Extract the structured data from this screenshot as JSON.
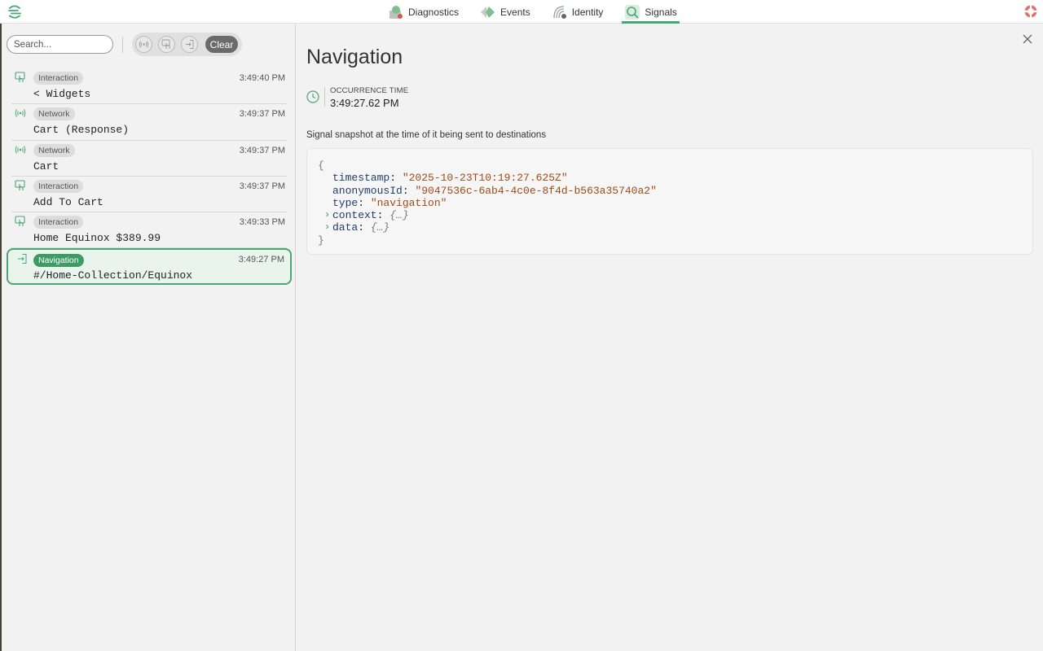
{
  "nav": {
    "tabs": [
      {
        "label": "Diagnostics",
        "icon": "diagnostics-icon"
      },
      {
        "label": "Events",
        "icon": "events-icon"
      },
      {
        "label": "Identity",
        "icon": "identity-icon"
      },
      {
        "label": "Signals",
        "icon": "signals-icon",
        "active": true
      }
    ]
  },
  "sidebar": {
    "search_placeholder": "Search...",
    "clear_label": "Clear",
    "signals": [
      {
        "type": "Interaction",
        "time": "3:49:40 PM",
        "title": "< Widgets",
        "icon": "interaction-icon"
      },
      {
        "type": "Network",
        "time": "3:49:37 PM",
        "title": "Cart (Response)",
        "icon": "network-icon"
      },
      {
        "type": "Network",
        "time": "3:49:37 PM",
        "title": "Cart",
        "icon": "network-icon"
      },
      {
        "type": "Interaction",
        "time": "3:49:37 PM",
        "title": "Add To Cart",
        "icon": "interaction-icon"
      },
      {
        "type": "Interaction",
        "time": "3:49:33 PM",
        "title": "Home Equinox $389.99",
        "icon": "interaction-icon"
      },
      {
        "type": "Navigation",
        "time": "3:49:27 PM",
        "title": "#/Home-Collection/Equinox",
        "icon": "navigation-icon",
        "selected": true
      }
    ]
  },
  "detail": {
    "title": "Navigation",
    "occurrence_label": "OCCURRENCE TIME",
    "occurrence_value": "3:49:27.62 PM",
    "snapshot_caption": "Signal snapshot at the time of it being sent to destinations",
    "json": {
      "open_brace": "{",
      "close_brace": "}",
      "timestamp_key": "timestamp",
      "timestamp_value": "\"2025-10-23T10:19:27.625Z\"",
      "anonymousId_key": "anonymousId",
      "anonymousId_value": "\"9047536c-6ab4-4c0e-8f4d-b563a35740a2\"",
      "type_key": "type",
      "type_value": "\"navigation\"",
      "context_key": "context",
      "data_key": "data",
      "collapsed": "{…}"
    }
  },
  "colors": {
    "accent": "#49a774",
    "accent_dark": "#3d9b63",
    "json_key": "#223c6e",
    "json_string": "#a04a16"
  }
}
